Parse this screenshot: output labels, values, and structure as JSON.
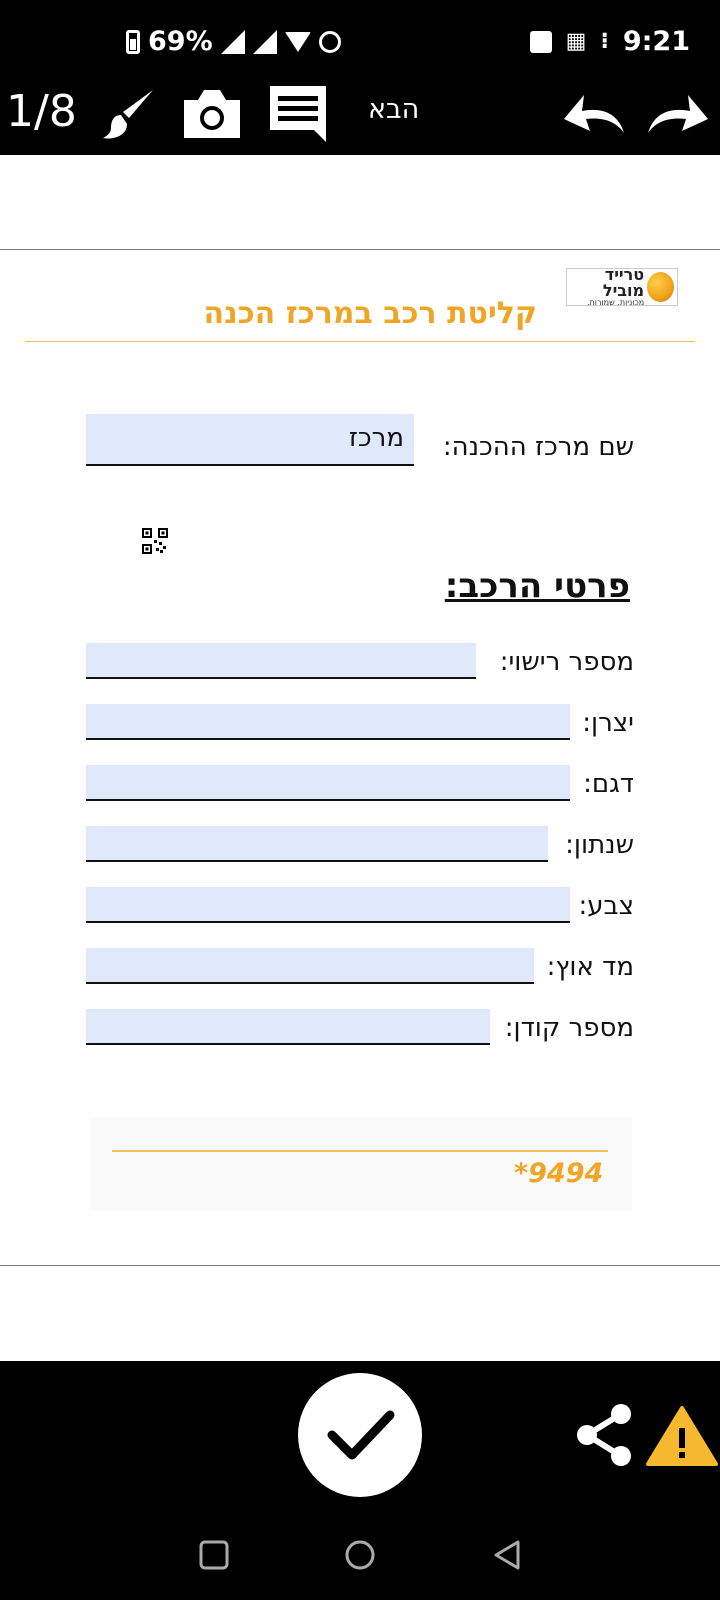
{
  "status_bar": {
    "battery": "69%",
    "time": "9:21"
  },
  "toolbar": {
    "page_indicator": "1/8",
    "next_label": "הבא",
    "icons": [
      "brush-icon",
      "camera-icon",
      "comment-icon",
      "undo-icon",
      "redo-icon"
    ]
  },
  "document": {
    "logo": {
      "name": "טרייד מוביל",
      "tagline": "מכוניות. שמורות."
    },
    "title": "קליטת רכב במרכז הכנה",
    "center": {
      "label": "שם מרכז ההכנה:",
      "value": "מרכז"
    },
    "section_title": "פרטי הרכב:",
    "fields": [
      {
        "label": "מספר רישוי:",
        "value": ""
      },
      {
        "label": "יצרן:",
        "value": ""
      },
      {
        "label": "דגם:",
        "value": ""
      },
      {
        "label": "שנתון:",
        "value": ""
      },
      {
        "label": "צבע:",
        "value": ""
      },
      {
        "label": "מד אוץ:",
        "value": ""
      },
      {
        "label": "מספר קודן:",
        "value": ""
      }
    ],
    "footer_code": "*9494"
  },
  "colors": {
    "accent": "#f0a526",
    "field_bg": "#e0e8fb",
    "bar_bg": "#000000",
    "warning": "#f5b82e"
  }
}
